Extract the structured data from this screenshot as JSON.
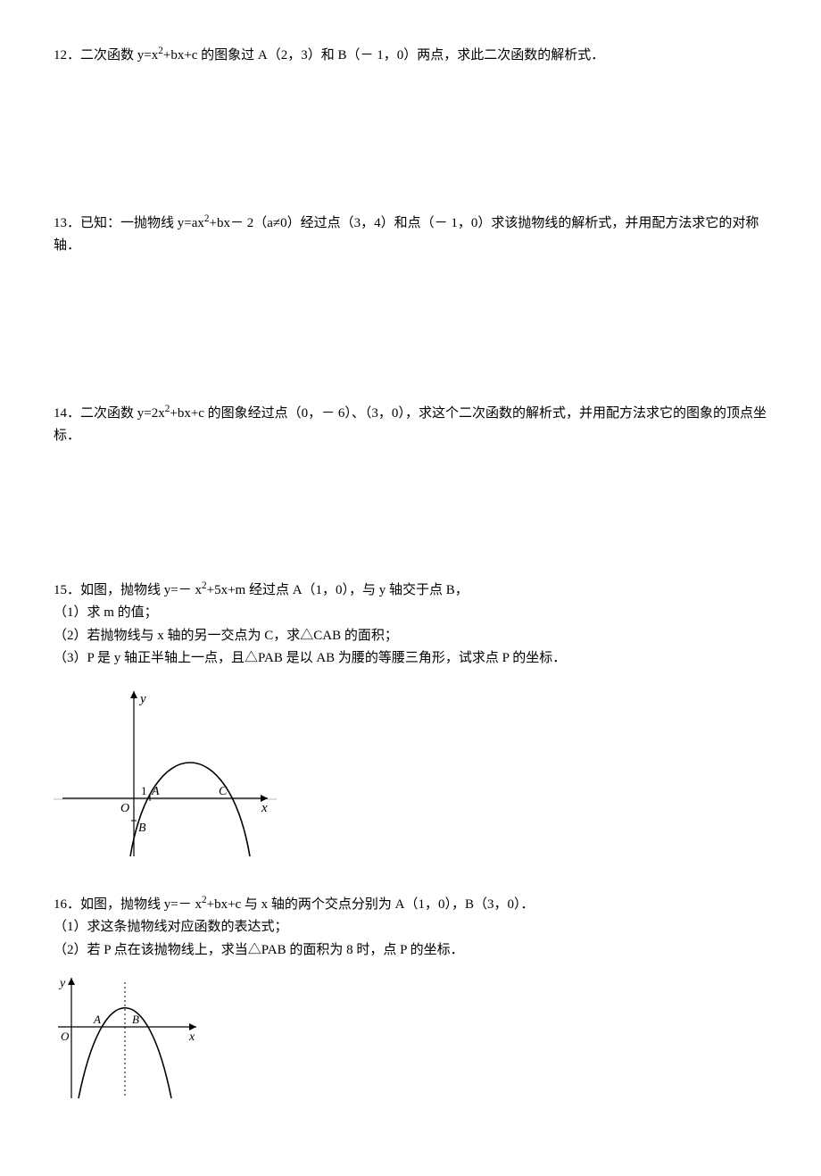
{
  "questions": {
    "q12": {
      "number": "12．",
      "text_a": "二次函数 y=x",
      "text_b": "+bx+c 的图象过 A（2，3）和 B（－ 1，0）两点，求此二次函数的解析式．"
    },
    "q13": {
      "number": "13．",
      "text_a": "已知：一抛物线 y=ax",
      "text_b": "+bx－ 2（a≠0）经过点（3，4）和点（－ 1，0）求该抛物线的解析式，并用配方法求它的对称轴．"
    },
    "q14": {
      "number": "14．",
      "text_a": "二次函数 y=2x",
      "text_b": "+bx+c 的图象经过点（0，－ 6）、（3，0），求这个二次函数的解析式，并用配方法求它的图象的顶点坐标．"
    },
    "q15": {
      "number": "15．",
      "text_a": "如图，抛物线 y=－ x",
      "text_b": "+5x+m 经过点 A（1，0），与 y 轴交于点 B，",
      "sub1": "（1）求 m 的值；",
      "sub2": "（2）若抛物线与 x 轴的另一交点为 C，求△CAB 的面积；",
      "sub3": "（3）P 是 y 轴正半轴上一点，且△PAB 是以 AB 为腰的等腰三角形，试求点 P 的坐标．",
      "fig": {
        "y": "y",
        "x": "x",
        "O": "O",
        "A": "A",
        "B": "B",
        "C": "C",
        "one": "1"
      }
    },
    "q16": {
      "number": "16．",
      "text_a": "如图，抛物线 y=－ x",
      "text_b": "+bx+c 与 x 轴的两个交点分别为 A（1，0），B（3，0）．",
      "sub1": "（1）求这条抛物线对应函数的表达式；",
      "sub2": "（2）若 P 点在该抛物线上，求当△PAB 的面积为 8 时，点 P 的坐标．",
      "fig": {
        "y": "y",
        "x": "x",
        "O": "O",
        "A": "A",
        "B": "B"
      }
    }
  }
}
